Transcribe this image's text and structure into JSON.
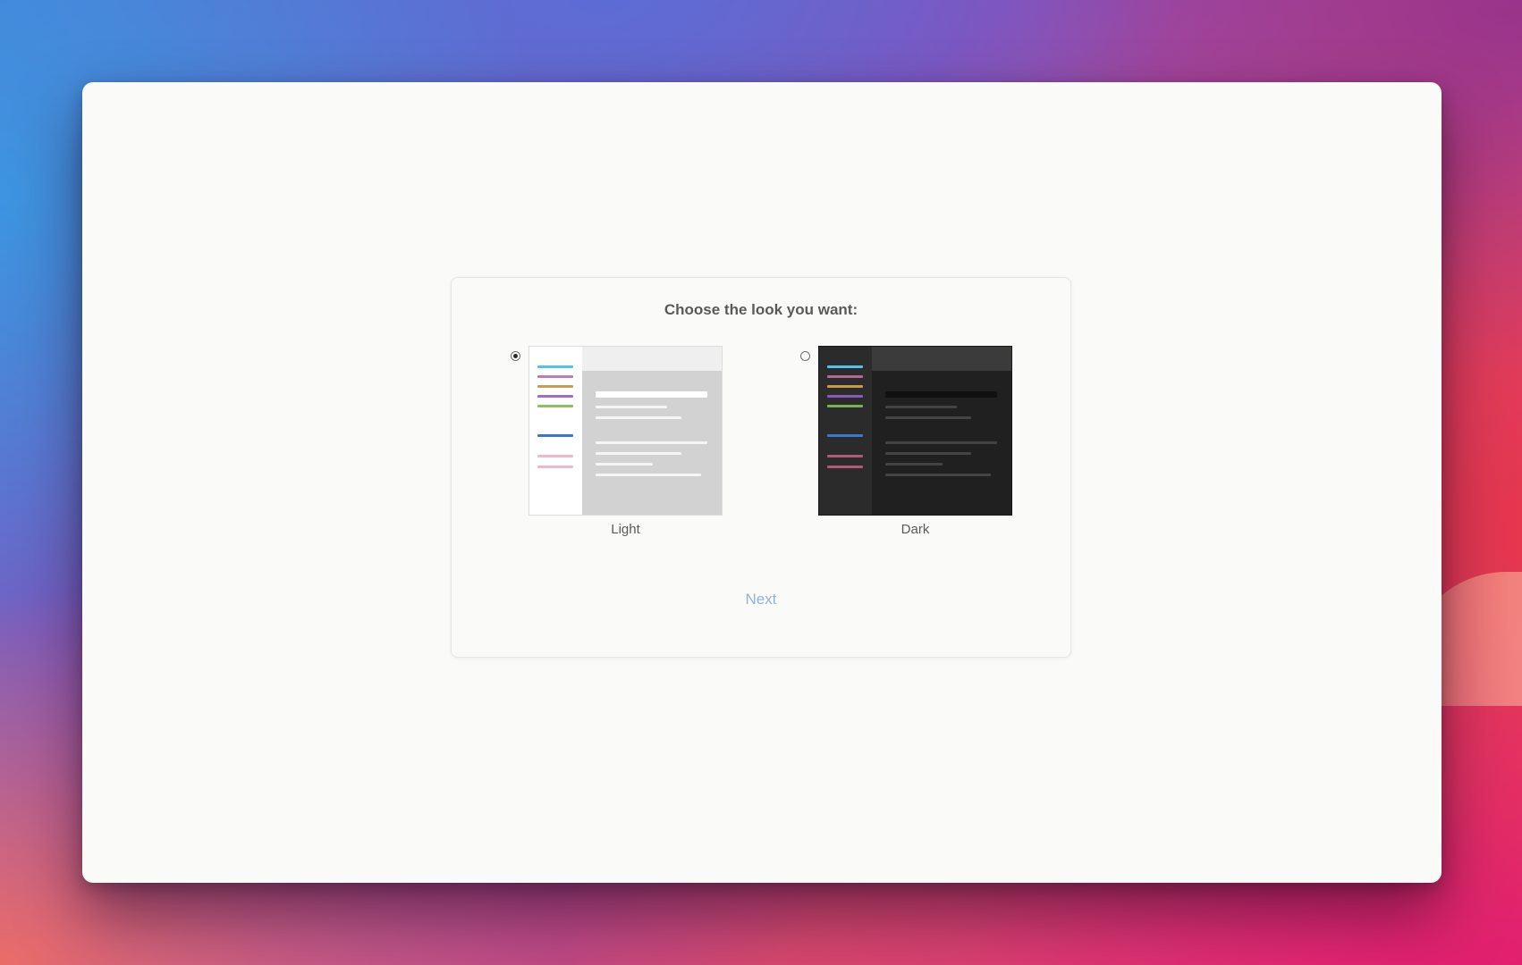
{
  "dialog": {
    "title": "Choose the look you want:",
    "next_label": "Next"
  },
  "themes": [
    {
      "id": "light",
      "label": "Light",
      "selected": true
    },
    {
      "id": "dark",
      "label": "Dark",
      "selected": false
    }
  ],
  "colors": {
    "next_link": "#8fb4d6",
    "accent_cyan": "#4fc3e8",
    "accent_mauve": "#c47ab0",
    "accent_gold": "#c8a04a",
    "accent_purple": "#a06cc8",
    "accent_green": "#8cc060",
    "accent_blue": "#3a78d0",
    "accent_pink": "#e8a8c0"
  }
}
